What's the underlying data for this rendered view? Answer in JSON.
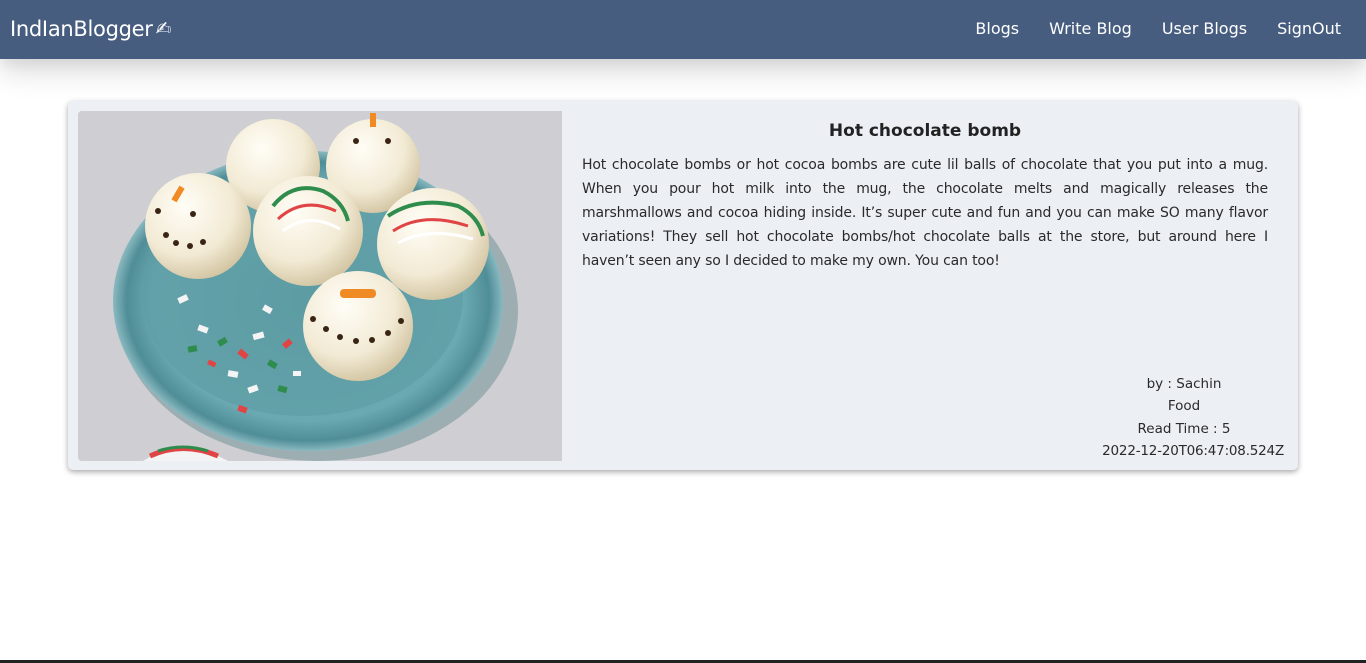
{
  "navbar": {
    "brand": "IndIanBlogger",
    "brand_icon": "writing-hand-icon",
    "links": [
      "Blogs",
      "Write Blog",
      "User Blogs",
      "SignOut"
    ]
  },
  "post": {
    "image_icon": "hot-chocolate-bombs-photo",
    "title": "Hot chocolate bomb",
    "body": "Hot chocolate bombs or hot cocoa bombs are cute lil balls of chocolate that you put into a mug. When you pour hot milk into the mug, the chocolate melts and magically releases the marshmallows and cocoa hiding inside. It’s super cute and fun and you can make SO many flavor variations! They sell hot chocolate bombs/hot chocolate balls at the store, but around here I haven’t seen any so I decided to make my own. You can too!",
    "author": "by : Sachin",
    "category": "Food",
    "read_time": "Read Time : 5",
    "timestamp": "2022-12-20T06:47:08.524Z"
  },
  "colors": {
    "navbar": "#475d80",
    "card": "#ecf0f5"
  }
}
